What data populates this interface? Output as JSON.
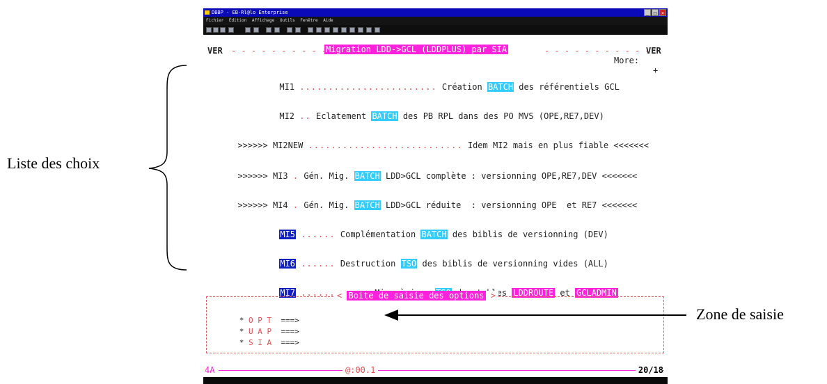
{
  "window": {
    "title": "DBBP - EB-Rl@lo Enterprise",
    "menu": [
      "Fichier",
      "Édition",
      "Affichage",
      "Outils",
      "Fenêtre",
      "Aide"
    ]
  },
  "screen": {
    "header_left": "VER",
    "header_title": "Migration LDD->GCL (LDDPLUS) par SIA",
    "header_right": "VER",
    "more_label": "More:",
    "more_sign": "+",
    "items": [
      {
        "code": "MI1",
        "dots": "........................",
        "text1": "Création",
        "tag": "BATCH",
        "text2": "des référentiels GCL"
      },
      {
        "code": "MI2",
        "dots": "..",
        "text1": "Eclatement",
        "tag": "BATCH",
        "text2": "des PB RPL dans des PO MVS (OPE,RE7,DEV)"
      },
      {
        "prefix": ">>>>>>",
        "code": "MI2NEW",
        "dots": "...........................",
        "text1": "Idem MI2 mais en plus fiable",
        "suffix": "<<<<<<<"
      },
      {
        "prefix": ">>>>>>",
        "code": "MI3",
        "dots": ".",
        "text1": "Gén. Mig.",
        "tag": "BATCH",
        "text2": "LDD>GCL complète : versionning OPE,RE7,DEV",
        "suffix": "<<<<<<<"
      },
      {
        "prefix": ">>>>>>",
        "code": "MI4",
        "dots": ".",
        "text1": "Gén. Mig.",
        "tag": "BATCH",
        "text2": "LDD>GCL réduite  : versionning OPE  et RE7",
        "suffix": "<<<<<<<"
      },
      {
        "code": "MI5",
        "dots": "......",
        "text1": "Complémentation",
        "tag": "BATCH",
        "text2": "des biblis de versionning (DEV)"
      },
      {
        "code": "MI6",
        "dots": "......",
        "text1": "Destruction",
        "tag": "TSO",
        "text2": "des biblis de versionning vides (ALL)"
      },
      {
        "code": "MI7",
        "dots": "............",
        "text1": "Mise à jour",
        "tag": "TSO",
        "text2": "des tables",
        "tag2": "LDDROUTE",
        "text3": "et",
        "tag3": "GCLADMIN"
      }
    ],
    "input_box": {
      "title": "Boite de saisie des options",
      "fields": [
        {
          "star": "*",
          "label": "O P T",
          "arrow": "===>"
        },
        {
          "star": "*",
          "label": "U A P",
          "arrow": "===>"
        },
        {
          "star": "*",
          "label": "S I A",
          "arrow": "===>"
        }
      ]
    },
    "status": {
      "left": "4A",
      "time": "@:00.1",
      "right": "20/18"
    }
  },
  "annotations": {
    "choices_label": "Liste des choix",
    "input_zone_label": "Zone de saisie"
  },
  "colors": {
    "magenta": "#ff22dd",
    "cyan": "#33ccff",
    "blue": "#1020c0",
    "dots": "#e05050"
  }
}
